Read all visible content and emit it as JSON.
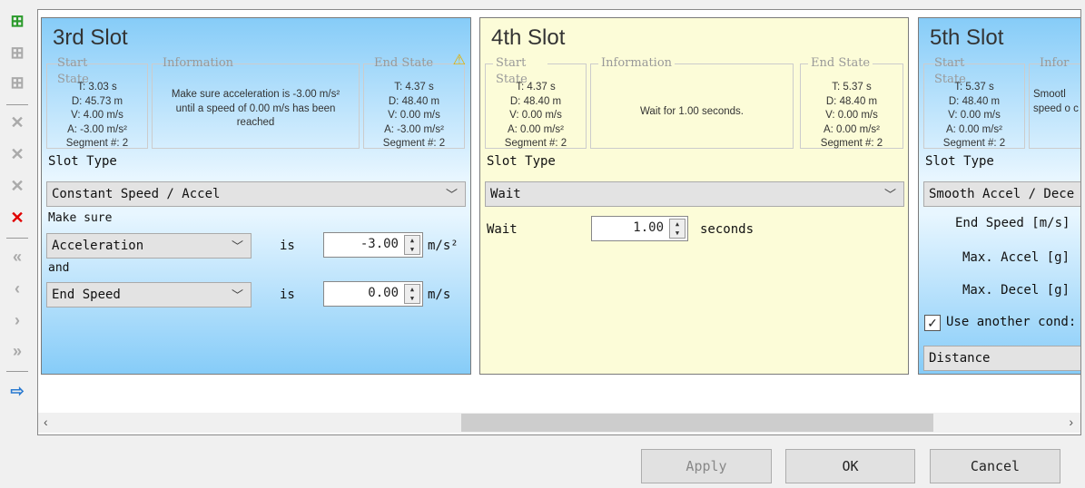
{
  "toolbar": {
    "items": [
      {
        "name": "insert-slot-icon",
        "color": "#2a9a2a"
      },
      {
        "name": "insert-before-icon"
      },
      {
        "name": "insert-after-icon"
      },
      {
        "name": "delete-slot-icon"
      },
      {
        "name": "delete-slot-2-icon"
      },
      {
        "name": "delete-slot-3-icon"
      },
      {
        "name": "delete-all-icon",
        "color": "#e00000"
      },
      {
        "name": "move-first-icon"
      },
      {
        "name": "move-left-icon"
      },
      {
        "name": "move-right-icon"
      },
      {
        "name": "move-last-icon"
      },
      {
        "name": "export-icon"
      }
    ]
  },
  "slots": [
    {
      "title": "3rd Slot",
      "start": {
        "legend": "Start State",
        "lines": [
          "T: 3.03 s",
          "D: 45.73 m",
          "V: 4.00 m/s",
          "A: -3.00 m/s²",
          "Segment #: 2"
        ]
      },
      "info": {
        "legend": "Information",
        "text": "Make sure acceleration is -3.00 m/s² until a speed of 0.00 m/s has been reached"
      },
      "end": {
        "legend": "End State",
        "lines": [
          "T: 4.37 s",
          "D: 48.40 m",
          "V: 0.00 m/s",
          "A: -3.00 m/s²",
          "Segment #: 2"
        ],
        "warning": true
      },
      "slot_type_label": "Slot Type",
      "slot_type": "Constant Speed / Accel",
      "make_sure": "Make sure",
      "and": "and",
      "is": "is",
      "cond1": {
        "field": "Acceleration",
        "value": "-3.00",
        "unit": "m/s²"
      },
      "cond2": {
        "field": "End Speed",
        "value": "0.00",
        "unit": "m/s"
      }
    },
    {
      "title": "4th Slot",
      "start": {
        "legend": "Start State",
        "lines": [
          "T: 4.37 s",
          "D: 48.40 m",
          "V: 0.00 m/s",
          "A: 0.00 m/s²",
          "Segment #: 2"
        ]
      },
      "info": {
        "legend": "Information",
        "text": "Wait for 1.00 seconds."
      },
      "end": {
        "legend": "End State",
        "lines": [
          "T: 5.37 s",
          "D: 48.40 m",
          "V: 0.00 m/s",
          "A: 0.00 m/s²",
          "Segment #: 2"
        ]
      },
      "slot_type_label": "Slot Type",
      "slot_type": "Wait",
      "wait_label": "Wait",
      "wait_value": "1.00",
      "wait_unit": "seconds"
    },
    {
      "title": "5th Slot",
      "start": {
        "legend": "Start State",
        "lines": [
          "T: 5.37 s",
          "D: 48.40 m",
          "V: 0.00 m/s",
          "A: 0.00 m/s²",
          "Segment #: 2"
        ]
      },
      "info": {
        "legend": "Infor",
        "text": "Smootl speed o c"
      },
      "slot_type_label": "Slot Type",
      "slot_type": "Smooth Accel / Dece",
      "end_speed": "End Speed [m/s]",
      "max_accel": "Max. Accel [g]",
      "max_decel": "Max. Decel [g]",
      "use_another": "Use another cond:",
      "use_another_checked": true,
      "condition": "Distance"
    }
  ],
  "buttons": {
    "apply": "Apply",
    "ok": "OK",
    "cancel": "Cancel"
  }
}
